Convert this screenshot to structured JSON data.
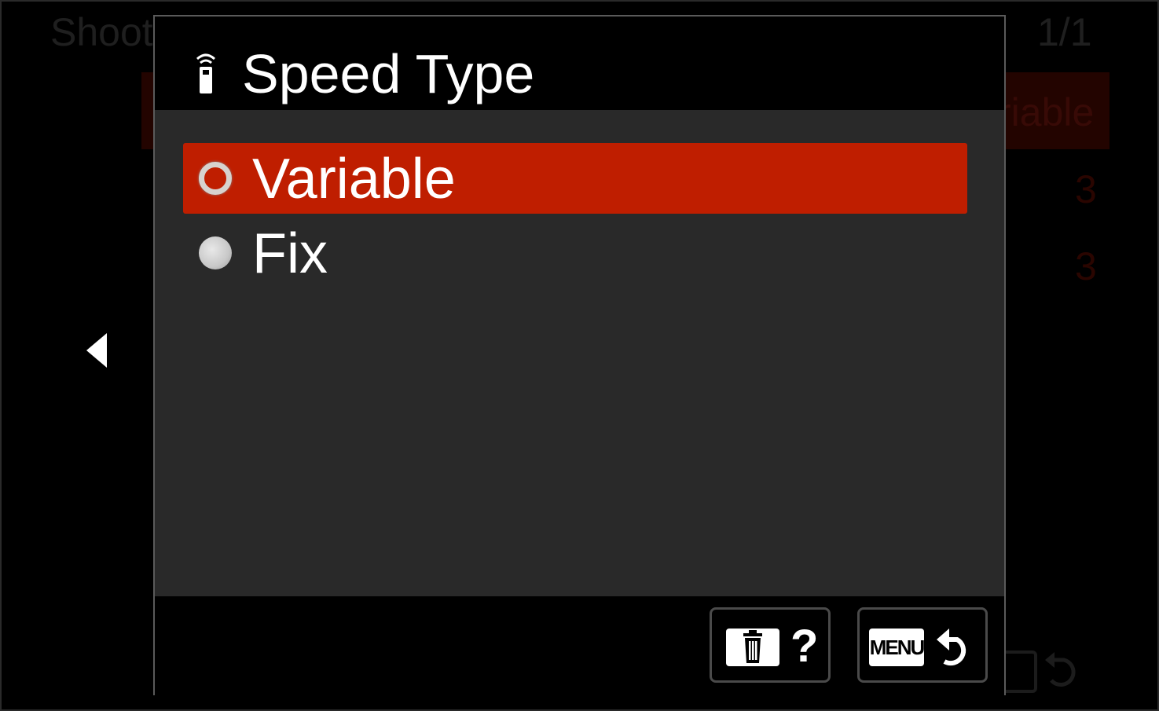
{
  "background": {
    "title": "Shooti",
    "page_indicator": "1/1",
    "selected_value": "riable",
    "values": [
      "3",
      "3"
    ]
  },
  "dialog": {
    "title": "Speed Type",
    "title_icon": "remote-shutter-icon",
    "options": [
      {
        "label": "Variable",
        "selected": true
      },
      {
        "label": "Fix",
        "selected": false
      }
    ]
  },
  "footer": {
    "help_icon": "trash-icon",
    "help_label": "?",
    "menu_label": "MENU",
    "back_icon": "return-arrow-icon"
  },
  "colors": {
    "accent": "#bf1e00",
    "panel": "#292929",
    "background": "#000000"
  }
}
